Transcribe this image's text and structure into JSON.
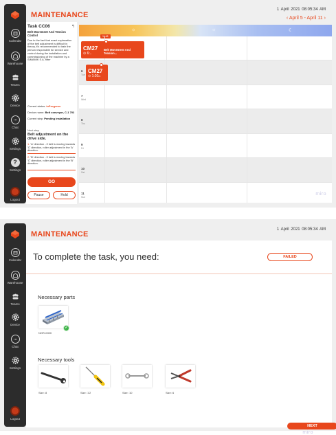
{
  "app": {
    "title": "MAINTENANCE",
    "brand_color": "#e8471c"
  },
  "nav": [
    {
      "label": "Calendar",
      "icon": "calendar-icon"
    },
    {
      "label": "Warehouse",
      "icon": "warehouse-icon"
    },
    {
      "label": "Teams",
      "icon": "teams-icon"
    },
    {
      "label": "Device",
      "icon": "gear-icon"
    },
    {
      "label": "Chat",
      "icon": "chat-icon"
    },
    {
      "label": "Settings",
      "icon": "gear-icon"
    },
    {
      "label": "Settings",
      "icon": "help-icon"
    }
  ],
  "logout": {
    "label": "Logout"
  },
  "datetime": {
    "day": "1",
    "month": "April",
    "year": "2021",
    "time": "08:05:34 AM"
  },
  "week_nav": {
    "prev": "‹",
    "range": "April 5 - April 11",
    "next": "›"
  },
  "task": {
    "title": "Task CC06",
    "back": "↰",
    "subtitle": "Belt Movement And Tension Control",
    "description": "Due to the fact that exact explanation of the belt adjustment is difficult in theory, it's recommended to train the person responsible for service and control during the installation and commissioning of the machine by a SIMAMIK S.A. fitter",
    "status_label": "Current status:",
    "status_value": "inProgress",
    "device_label": "Device name:",
    "device_value": "Belt conveyor, C-1 702",
    "step_label": "Current step:",
    "step_value": "Pending installation",
    "next_step_label": "Next step",
    "next_step": "Belt adjustment on the drive side.",
    "dir1_num": "1.",
    "dir1": "'A' direction - if belt is moving towards 'C' direction, roller adjustment in the 'A' direction.",
    "dir2_num": "2.",
    "dir2": "'B' direction - if belt is moving towards 'C' direction, roller adjustment in the 'B' direction.",
    "go": "GO",
    "pause": "Pause",
    "hold": "Hold"
  },
  "calendar": {
    "now_tag": "11:48",
    "sun_icon": "☼",
    "cloud_icon": "☼",
    "moon_icon": "☾",
    "days": [
      {
        "num": "5",
        "name": "Mon"
      },
      {
        "num": "6",
        "name": "Tue"
      },
      {
        "num": "7",
        "name": "Wed"
      },
      {
        "num": "8",
        "name": "Thu"
      },
      {
        "num": "9",
        "name": "Fri"
      },
      {
        "num": "10",
        "name": "Sat"
      },
      {
        "num": "11",
        "name": "Sun"
      }
    ],
    "events": [
      {
        "code": "CM27",
        "time": "⊙ 6:..",
        "name": "Belt Movement And Tension..."
      },
      {
        "code": "CM27",
        "time": "⊙ 1:20",
        "suffix": "m"
      }
    ],
    "watermark": "miro"
  },
  "requirements": {
    "title": "To complete the task, you need:",
    "status": "FAILED",
    "parts_title": "Necessary parts",
    "parts": [
      {
        "caption": "NOR-0000",
        "icon": "conveyor-part-icon",
        "available": true
      }
    ],
    "tools_title": "Necessary tools",
    "tools": [
      {
        "caption": "Size: 8",
        "icon": "wrench-icon"
      },
      {
        "caption": "Size: 1'2",
        "icon": "screwdriver-icon"
      },
      {
        "caption": "Size: 10",
        "icon": "spanner-icon"
      },
      {
        "caption": "Size: 6",
        "icon": "pliers-icon"
      }
    ],
    "next": "NEXT",
    "watermark": "miro"
  }
}
